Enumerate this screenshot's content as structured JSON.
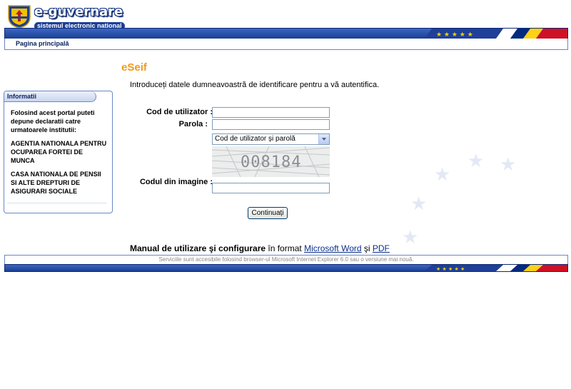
{
  "header": {
    "brand_title": "e-guvernare",
    "brand_subtitle": "sistemul electronic national"
  },
  "nav": {
    "home_label": "Pagina principală"
  },
  "sidebar": {
    "title": "Informatii",
    "intro": "Folosind acest portal puteti depune declaratii catre urmatoarele institutii:",
    "institutions": [
      "AGENTIA NATIONALA PENTRU OCUPAREA FORTEI DE MUNCA",
      "CASA NATIONALA DE PENSII SI ALTE DREPTURI DE ASIGURARI SOCIALE"
    ]
  },
  "main": {
    "title": "eSeif",
    "intro": "Introduceți datele dumneavoastră de identificare pentru a vă autentifica.",
    "form": {
      "username_label": "Cod de utilizator :",
      "username_value": "",
      "password_label": "Parola :",
      "password_value": "",
      "auth_method_selected": "Cod de utilizator și parolă",
      "captcha_text": "008184",
      "captcha_label": "Codul din imagine :",
      "captcha_value": "",
      "submit_label": "Continuați"
    },
    "manual": {
      "prefix": "Manual de utilizare şi configurare",
      "middle": " în format ",
      "word_link": "Microsoft Word",
      "and": " şi ",
      "pdf_link": "PDF"
    }
  },
  "footer": {
    "notice": "Serviciile sunt accesibile folosind browser-ul Microsoft Internet Explorer 6.0 sau o versiune mai nouă."
  },
  "colors": {
    "brand_blue": "#1c3f92",
    "title_orange": "#f39a19",
    "link_blue": "#0a2f8a"
  }
}
